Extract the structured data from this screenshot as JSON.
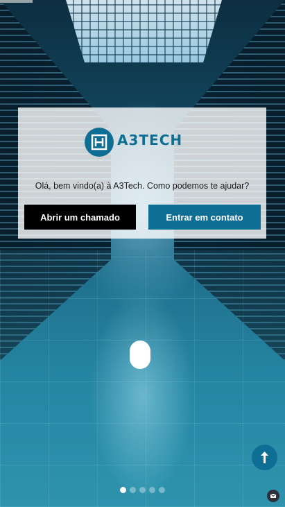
{
  "logo": {
    "text": "A3TECH",
    "color": "#0e6e93"
  },
  "hero": {
    "greeting": "Olá, bem vindo(a) à A3Tech. Como podemos te ajudar?",
    "primary_button": "Abrir um chamado",
    "secondary_button": "Entrar em contato"
  },
  "carousel": {
    "slides": 5,
    "active_index": 0
  },
  "icons": {
    "scroll": "mouse-scroll-icon",
    "back_to_top": "arrow-up-icon",
    "mail": "envelope-icon"
  },
  "colors": {
    "accent": "#0e6e93",
    "dark_button": "#000000"
  }
}
